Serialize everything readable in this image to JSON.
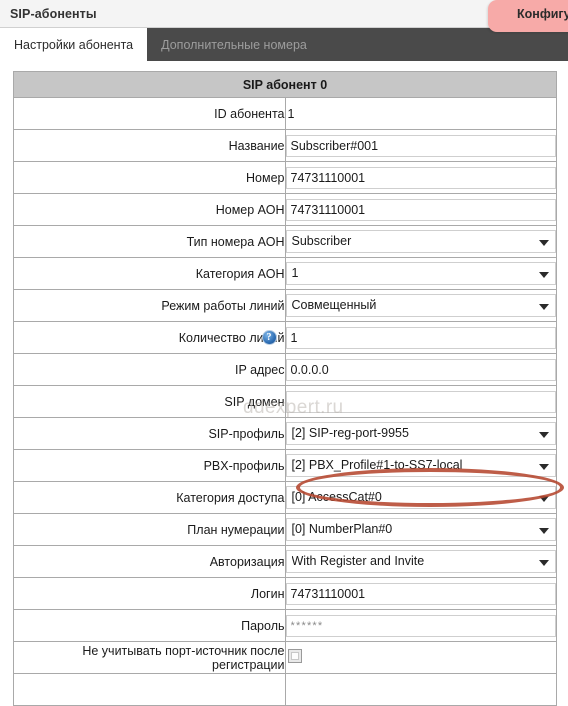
{
  "titlebar": {
    "title": "SIP-абоненты",
    "pink_tab_label": "Конфигу",
    "pink_tab_color": "#f7aaa8"
  },
  "tabs": [
    {
      "label": "Настройки абонента",
      "active": true
    },
    {
      "label": "Дополнительные номера",
      "active": false
    }
  ],
  "watermark": "ddexpert.ru",
  "form": {
    "header": "SIP абонент 0",
    "rows": [
      {
        "label": "ID абонента",
        "type": "text",
        "value": "1"
      },
      {
        "label": "Название",
        "type": "input",
        "value": "Subscriber#001"
      },
      {
        "label": "Номер",
        "type": "input",
        "value": "74731110001"
      },
      {
        "label": "Номер АОН",
        "type": "input",
        "value": "74731110001"
      },
      {
        "label": "Тип номера АОН",
        "type": "select",
        "value": "Subscriber"
      },
      {
        "label": "Категория АОН",
        "type": "select",
        "value": "1"
      },
      {
        "label": "Режим работы линий",
        "type": "select",
        "value": "Совмещенный"
      },
      {
        "label": "Количество линий",
        "type": "input",
        "value": "1",
        "help": true
      },
      {
        "label": "IP адрес",
        "type": "input",
        "value": "0.0.0.0"
      },
      {
        "label": "SIP домен",
        "type": "input",
        "value": ""
      },
      {
        "label": "SIP-профиль",
        "type": "select",
        "value": "[2] SIP-reg-port-9955"
      },
      {
        "label": "PBX-профиль",
        "type": "select",
        "value": "[2] PBX_Profile#1-to-SS7-local",
        "highlighted": true
      },
      {
        "label": "Категория доступа",
        "type": "select",
        "value": "[0] AccessCat#0"
      },
      {
        "label": "План нумерации",
        "type": "select",
        "value": "[0] NumberPlan#0"
      },
      {
        "label": "Авторизация",
        "type": "select",
        "value": "With Register and Invite"
      },
      {
        "label": "Логин",
        "type": "input",
        "value": "74731110001"
      },
      {
        "label": "Пароль",
        "type": "password",
        "value": "******"
      },
      {
        "label": "Не учитывать порт-источник после регистрации",
        "type": "checkbox",
        "value": ""
      },
      {
        "label": "",
        "type": "partial",
        "value": ""
      }
    ]
  },
  "annotation": {
    "shape": "ellipse",
    "color": "#b5472f",
    "targets_row": "PBX-профиль"
  }
}
